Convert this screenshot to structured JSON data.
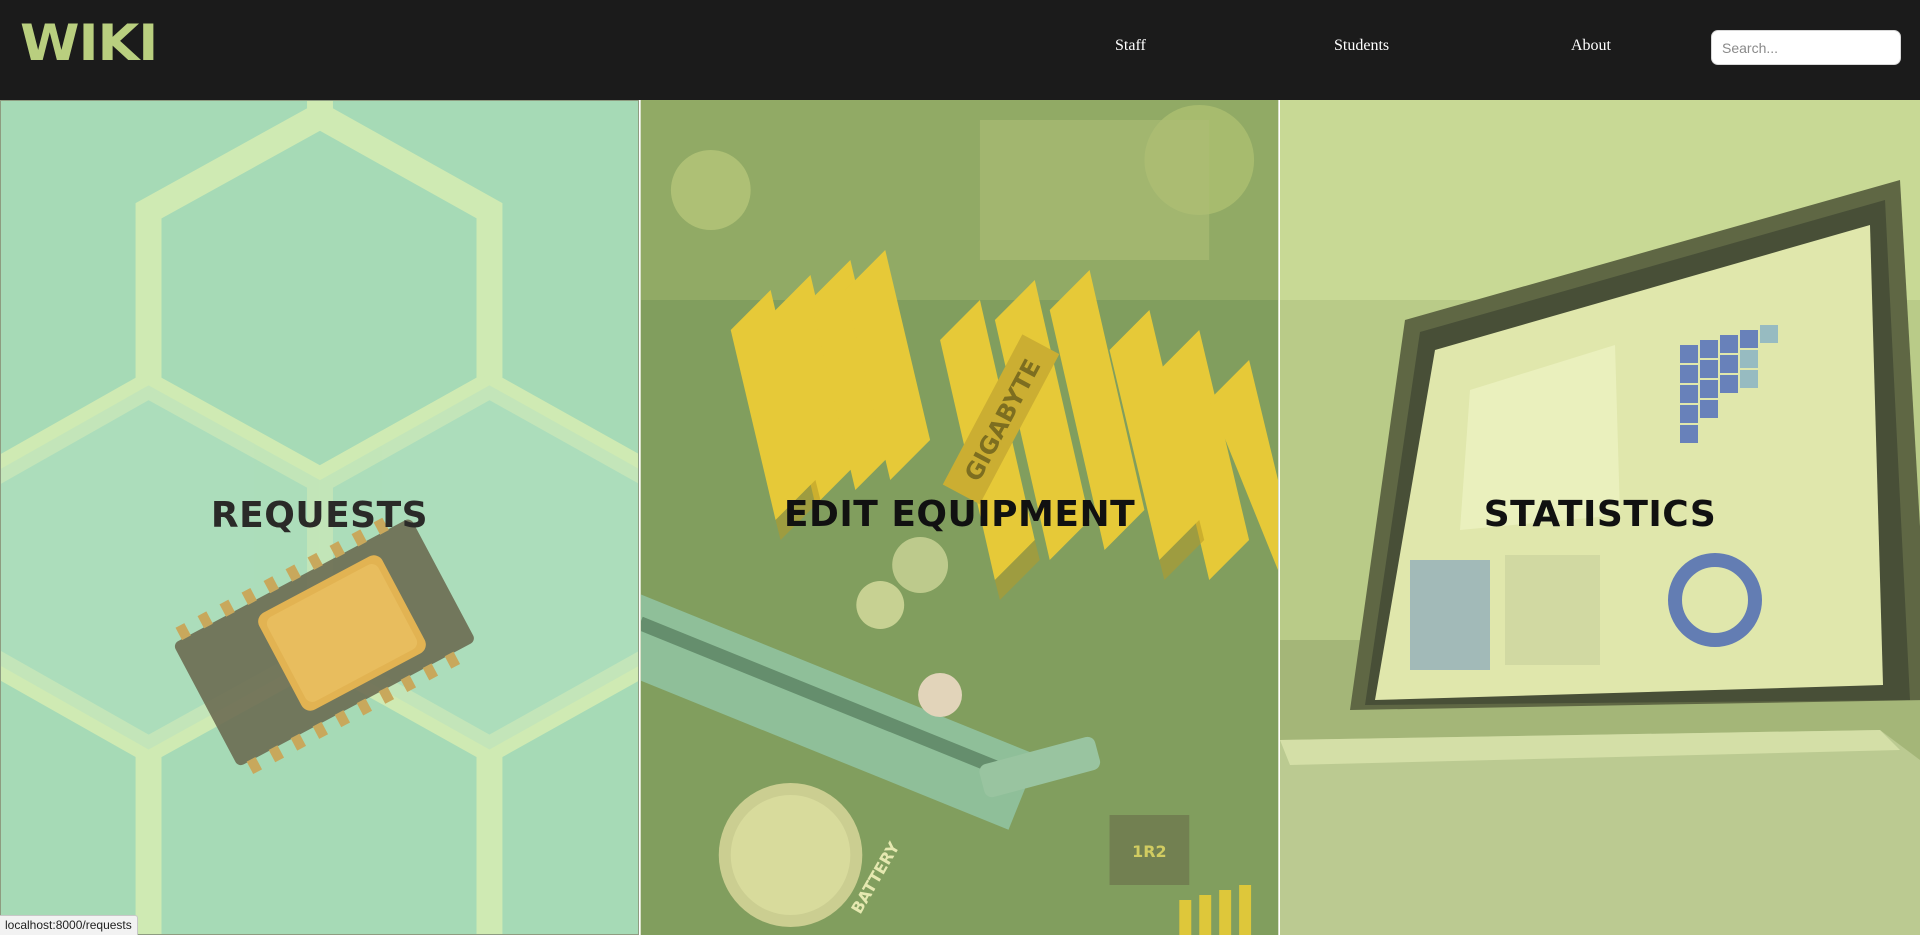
{
  "brand": {
    "logo_text": "WIKI",
    "accent": "#b9cf7f"
  },
  "nav": {
    "items": [
      {
        "label": "Staff"
      },
      {
        "label": "Students"
      },
      {
        "label": "About"
      }
    ],
    "search_placeholder": "Search..."
  },
  "tiles": [
    {
      "label": "REQUESTS",
      "image": "microchip-on-hexagon-pattern",
      "tint": "#a8dcb4"
    },
    {
      "label": "EDIT EQUIPMENT",
      "image": "motherboard-heatsinks",
      "tint": "#d8e878"
    },
    {
      "label": "STATISTICS",
      "image": "laptop-with-analytics-dashboard",
      "tint": "#c4d88c"
    }
  ],
  "status_bar": {
    "url": "localhost:8000/requests"
  }
}
